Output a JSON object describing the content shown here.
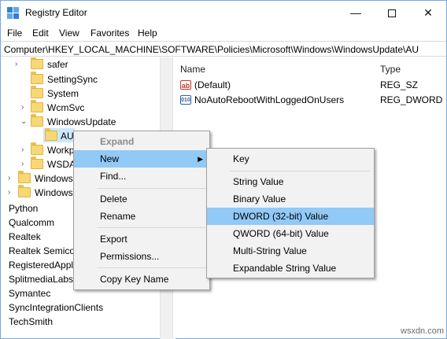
{
  "window": {
    "title": "Registry Editor",
    "minimize": "—",
    "close": "✕"
  },
  "menubar": [
    "File",
    "Edit",
    "View",
    "Favorites",
    "Help"
  ],
  "address": "Computer\\HKEY_LOCAL_MACHINE\\SOFTWARE\\Policies\\Microsoft\\Windows\\WindowsUpdate\\AU",
  "tree": {
    "items": [
      {
        "label": "safer"
      },
      {
        "label": "SettingSync"
      },
      {
        "label": "System"
      },
      {
        "label": "WcmSvc"
      },
      {
        "label": "WindowsUpdate"
      },
      {
        "label": "AU"
      },
      {
        "label": "Workp"
      },
      {
        "label": "WSDA"
      },
      {
        "label": "Windows"
      },
      {
        "label": "Windows"
      },
      {
        "label": "Python"
      },
      {
        "label": "Qualcomm"
      },
      {
        "label": "Realtek"
      },
      {
        "label": "Realtek Semico"
      },
      {
        "label": "RegisteredAppl"
      },
      {
        "label": "SplitmediaLabs"
      },
      {
        "label": "Symantec"
      },
      {
        "label": "SyncIntegrationClients"
      },
      {
        "label": "TechSmith"
      }
    ]
  },
  "values": {
    "headers": {
      "name": "Name",
      "type": "Type"
    },
    "rows": [
      {
        "name": "(Default)",
        "type": "REG_SZ",
        "icon": "ab"
      },
      {
        "name": "NoAutoRebootWithLoggedOnUsers",
        "type": "REG_DWORD",
        "icon": "010"
      }
    ]
  },
  "context_menu": {
    "items": [
      {
        "label": "Expand"
      },
      {
        "label": "New"
      },
      {
        "label": "Find..."
      },
      {
        "label": "Delete"
      },
      {
        "label": "Rename"
      },
      {
        "label": "Export"
      },
      {
        "label": "Permissions..."
      },
      {
        "label": "Copy Key Name"
      }
    ]
  },
  "submenu": {
    "items": [
      {
        "label": "Key"
      },
      {
        "label": "String Value"
      },
      {
        "label": "Binary Value"
      },
      {
        "label": "DWORD (32-bit) Value"
      },
      {
        "label": "QWORD (64-bit) Value"
      },
      {
        "label": "Multi-String Value"
      },
      {
        "label": "Expandable String Value"
      }
    ]
  },
  "watermark": "wsxdn.com",
  "colors": {
    "hover": "#91c9f7",
    "selection": "#cce8ff",
    "folder": "#f8d775"
  }
}
